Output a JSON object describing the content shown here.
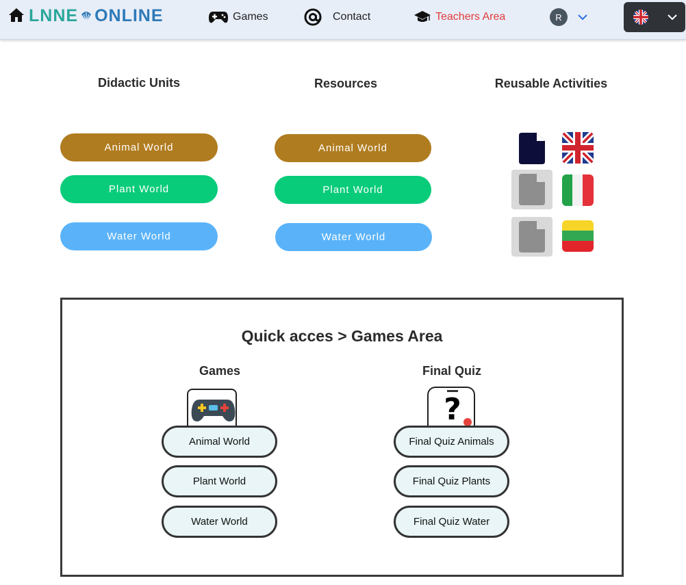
{
  "header": {
    "logo_part1": "LNNE",
    "logo_part2": "ONLINE",
    "nav": {
      "games": "Games",
      "contact": "Contact",
      "teachers": "Teachers Area"
    },
    "user_initial": "R",
    "language": "English (UK)"
  },
  "columns": {
    "didactic_title": "Didactic Units",
    "resources_title": "Resources",
    "reusable_title": "Reusable Activities"
  },
  "didactic_units": [
    "Animal World",
    "Plant World",
    "Water World"
  ],
  "resources": [
    "Animal World",
    "Plant World",
    "Water World"
  ],
  "reusable_activities": [
    {
      "icon": "document-icon",
      "language": "English"
    },
    {
      "icon": "document-icon",
      "language": "Italian"
    },
    {
      "icon": "document-icon",
      "language": "Lithuanian"
    }
  ],
  "quick_access": {
    "title": "Quick acces > Games Area",
    "games_title": "Games",
    "quiz_title": "Final Quiz",
    "games": [
      "Animal World",
      "Plant World",
      "Water World"
    ],
    "quizzes": [
      "Final Quiz Animals",
      "Final Quiz Plants",
      "Final Quiz Water"
    ]
  },
  "colors": {
    "brown": "#b07c20",
    "green": "#08cc7a",
    "blue": "#5ab3f9",
    "teachers_red": "#e23b3b",
    "header_bg": "#e8eef8"
  }
}
